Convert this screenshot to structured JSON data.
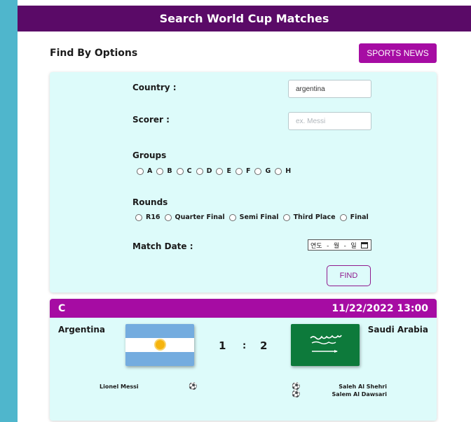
{
  "header": {
    "title": "Search World Cup Matches"
  },
  "options": {
    "heading": "Find By Options",
    "news_button": "SPORTS NEWS",
    "country": {
      "label": "Country :",
      "value": "argentina",
      "placeholder": ""
    },
    "scorer": {
      "label": "Scorer :",
      "value": "",
      "placeholder": "ex. Messi"
    },
    "groups": {
      "label": "Groups",
      "options": [
        "A",
        "B",
        "C",
        "D",
        "E",
        "F",
        "G",
        "H"
      ]
    },
    "rounds": {
      "label": "Rounds",
      "options": [
        "R16",
        "Quarter Final",
        "Semi Final",
        "Third Place",
        "Final"
      ]
    },
    "match_date": {
      "label": "Match Date :",
      "value": "연도 - 월 - 일"
    },
    "find_button": "FIND"
  },
  "match": {
    "group": "C",
    "datetime": "11/22/2022 13:00",
    "home": {
      "name": "Argentina",
      "score": "1",
      "scorers": [
        "Lionel Messi"
      ]
    },
    "separator": ":",
    "away": {
      "name": "Saudi Arabia",
      "score": "2",
      "scorers": [
        "Saleh Al Shehri",
        "Salem Al Dawsari"
      ]
    }
  },
  "colors": {
    "header": "#5a0a67",
    "accent": "#a60ca3",
    "panel": "#ddfbfa",
    "side": "#4fb6cc"
  }
}
